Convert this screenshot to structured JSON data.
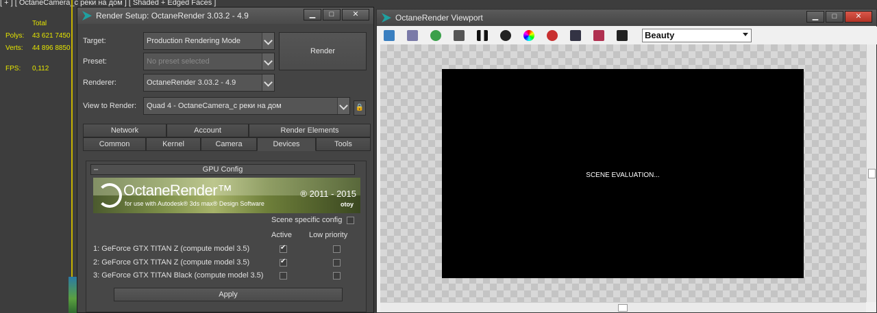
{
  "background": {
    "viewport_label": "[ + ] [ OctaneCamera_с реки на дом ] [ Shaded + Edged Faces ]",
    "stats": {
      "total_label": "Total",
      "polys_label": "Polys:",
      "polys_value": "43 621 7450",
      "verts_label": "Verts:",
      "verts_value": "44 896 8850",
      "fps_label": "FPS:",
      "fps_value": "0,112"
    }
  },
  "render_setup": {
    "title": "Render Setup: OctaneRender 3.03.2 - 4.9",
    "target_label": "Target:",
    "target_value": "Production Rendering Mode",
    "preset_label": "Preset:",
    "preset_value": "No preset selected",
    "renderer_label": "Renderer:",
    "renderer_value": "OctaneRender 3.03.2 - 4.9",
    "view_label": "View to Render:",
    "view_value": "Quad 4 - OctaneCamera_с реки на дом",
    "render_button": "Render",
    "tabs_row1": [
      "Network",
      "Account",
      "Render Elements"
    ],
    "tabs_row2": [
      "Common",
      "Kernel",
      "Camera",
      "Devices",
      "Tools"
    ],
    "active_tab": "Devices",
    "rollout": {
      "minus": "–",
      "title": "GPU Config",
      "banner": {
        "title": "OctaneRender™",
        "subtitle": "for use with Autodesk® 3ds max® Design Software",
        "years": "® 2011 - 2015",
        "brand": "otoy"
      },
      "scene_specific_label": "Scene specific config",
      "scene_specific_checked": false,
      "col_active": "Active",
      "col_low_priority": "Low priority",
      "devices": [
        {
          "label": "1:  GeForce GTX TITAN Z (compute model 3.5)",
          "active": true,
          "low_priority": false
        },
        {
          "label": "2:  GeForce GTX TITAN Z (compute model 3.5)",
          "active": true,
          "low_priority": false
        },
        {
          "label": "3:  GeForce GTX TITAN Black (compute model 3.5)",
          "active": false,
          "low_priority": false
        }
      ],
      "apply_button": "Apply"
    }
  },
  "octane_viewport": {
    "title": "OctaneRender Viewport",
    "render_pass": "Beauty",
    "status_message": "SCENE EVALUATION...",
    "toolbar_icons": [
      "save-icon",
      "clipboard-icon",
      "refresh-icon",
      "lock-icon",
      "pause-icon",
      "af-icon",
      "color-picker-icon",
      "region-icon",
      "film-icon",
      "calendar-icon",
      "camera-icon"
    ]
  },
  "window_buttons": {
    "minimize": "▁",
    "maximize": "□",
    "close": "✕"
  }
}
